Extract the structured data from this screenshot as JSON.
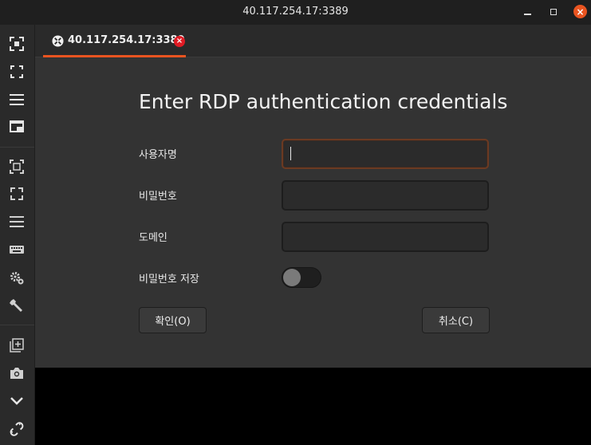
{
  "window": {
    "title": "40.117.254.17:3389",
    "minimize_icon": "minimize-icon",
    "maximize_icon": "maximize-icon",
    "close_icon": "close-icon",
    "accent_color": "#e95420"
  },
  "sidebar": {
    "items": [
      {
        "icon": "fit-screen-icon"
      },
      {
        "icon": "fullscreen-icon"
      },
      {
        "icon": "menu-icon"
      },
      {
        "icon": "picture-in-picture-icon"
      },
      {
        "icon": "dynamic-resolution-icon"
      },
      {
        "icon": "scale-icon"
      },
      {
        "icon": "list-icon"
      },
      {
        "icon": "keyboard-icon"
      },
      {
        "icon": "settings-icon"
      },
      {
        "icon": "tools-icon"
      },
      {
        "icon": "duplicate-icon"
      },
      {
        "icon": "screenshot-icon"
      },
      {
        "icon": "chevron-down-icon"
      },
      {
        "icon": "disconnect-icon"
      }
    ]
  },
  "tab": {
    "label": "40.117.254.17:3389",
    "close_color": "#e01b24"
  },
  "dialog": {
    "heading": "Enter RDP authentication credentials",
    "username_label": "사용자명",
    "username_value": "",
    "password_label": "비밀번호",
    "password_value": "",
    "domain_label": "도메인",
    "domain_value": "",
    "save_password_label": "비밀번호 저장",
    "save_password_on": false,
    "ok_label": "확인(O)",
    "cancel_label": "취소(C)"
  }
}
